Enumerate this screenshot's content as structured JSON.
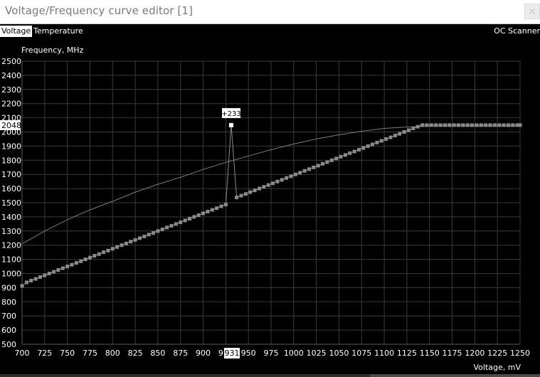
{
  "window": {
    "title": "Voltage/Frequency curve editor [1]"
  },
  "tabs": [
    {
      "label": "Voltage",
      "active": true
    },
    {
      "label": "Temperature",
      "active": false
    }
  ],
  "oc_scanner_label": "OC Scanner",
  "colors": {
    "background": "#000000",
    "grid": "#3a3a3a",
    "axis_text": "#ffffff",
    "curve_points": "#8a8a8a",
    "max_curve": "#7d7d7d",
    "selected": "#ffffff"
  },
  "chart_data": {
    "type": "line",
    "ylabel": "Frequency, MHz",
    "xlabel": "Voltage, mV",
    "xlim": [
      700,
      1250
    ],
    "ylim": [
      500,
      2500
    ],
    "x_ticks": [
      700,
      725,
      750,
      775,
      800,
      825,
      850,
      875,
      900,
      925,
      950,
      975,
      1000,
      1025,
      1050,
      1075,
      1100,
      1125,
      1150,
      1175,
      1200,
      1225,
      1250
    ],
    "y_ticks": [
      500,
      600,
      700,
      800,
      900,
      1000,
      1100,
      1200,
      1300,
      1400,
      1500,
      1600,
      1700,
      1800,
      1900,
      2000,
      2100,
      2200,
      2300,
      2400,
      2500
    ],
    "grid": true,
    "selected_point": {
      "voltage_label": "931",
      "frequency_label": "2048",
      "offset_label": "+233",
      "voltage": 931,
      "frequency": 2048
    },
    "series": [
      {
        "name": "",
        "style": "line",
        "points": [
          [
            700,
            1210
          ],
          [
            725,
            1300
          ],
          [
            750,
            1380
          ],
          [
            775,
            1450
          ],
          [
            800,
            1510
          ],
          [
            825,
            1575
          ],
          [
            850,
            1630
          ],
          [
            875,
            1680
          ],
          [
            900,
            1735
          ],
          [
            925,
            1785
          ],
          [
            950,
            1830
          ],
          [
            975,
            1875
          ],
          [
            1000,
            1915
          ],
          [
            1025,
            1950
          ],
          [
            1050,
            1980
          ],
          [
            1075,
            2005
          ],
          [
            1100,
            2025
          ],
          [
            1125,
            2035
          ],
          [
            1150,
            2040
          ],
          [
            1175,
            2040
          ],
          [
            1200,
            2040
          ],
          [
            1225,
            2040
          ],
          [
            1250,
            2040
          ]
        ]
      },
      {
        "name": "",
        "style": "markers",
        "x": [
          700,
          705,
          710,
          715,
          720,
          725,
          730,
          735,
          740,
          745,
          750,
          755,
          760,
          765,
          770,
          775,
          780,
          785,
          790,
          795,
          800,
          805,
          810,
          815,
          820,
          825,
          830,
          835,
          840,
          845,
          850,
          855,
          860,
          865,
          870,
          875,
          880,
          885,
          890,
          895,
          900,
          905,
          910,
          915,
          920,
          925,
          931,
          937,
          942,
          947,
          952,
          957,
          962,
          967,
          972,
          977,
          982,
          987,
          992,
          997,
          1002,
          1007,
          1012,
          1017,
          1022,
          1027,
          1032,
          1037,
          1042,
          1047,
          1052,
          1057,
          1062,
          1067,
          1072,
          1077,
          1082,
          1087,
          1092,
          1097,
          1102,
          1107,
          1112,
          1117,
          1122,
          1127,
          1132,
          1137,
          1142,
          1147,
          1152,
          1157,
          1162,
          1167,
          1172,
          1177,
          1182,
          1187,
          1192,
          1197,
          1202,
          1207,
          1212,
          1217,
          1222,
          1227,
          1232,
          1237,
          1242,
          1247,
          1250
        ],
        "y": [
          912,
          937,
          950,
          962,
          975,
          987,
          1000,
          1012,
          1025,
          1037,
          1050,
          1062,
          1075,
          1087,
          1100,
          1112,
          1125,
          1137,
          1150,
          1162,
          1175,
          1187,
          1200,
          1212,
          1225,
          1237,
          1250,
          1262,
          1275,
          1287,
          1300,
          1312,
          1325,
          1337,
          1350,
          1362,
          1375,
          1387,
          1400,
          1412,
          1425,
          1437,
          1450,
          1462,
          1475,
          1487,
          2048,
          1537,
          1550,
          1562,
          1575,
          1587,
          1600,
          1612,
          1625,
          1637,
          1650,
          1662,
          1675,
          1687,
          1700,
          1712,
          1725,
          1737,
          1750,
          1762,
          1775,
          1787,
          1800,
          1812,
          1825,
          1837,
          1850,
          1862,
          1875,
          1887,
          1900,
          1912,
          1925,
          1937,
          1950,
          1962,
          1975,
          1987,
          2000,
          2012,
          2025,
          2037,
          2048,
          2048,
          2048,
          2048,
          2048,
          2048,
          2048,
          2048,
          2048,
          2048,
          2048,
          2048,
          2048,
          2048,
          2048,
          2048,
          2048,
          2048,
          2048,
          2048,
          2048,
          2048,
          2048
        ]
      }
    ]
  }
}
